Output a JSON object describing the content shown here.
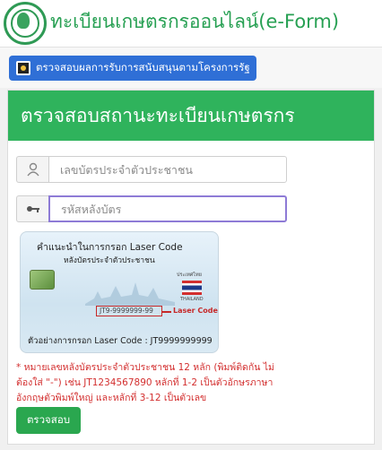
{
  "header": {
    "title": "ทะเบียนเกษตรกรออนไลน์(e-Form)"
  },
  "toolbar": {
    "gov_button_label": "ตรวจสอบผลการรับการสนับสนุนตามโครงการรัฐ"
  },
  "card": {
    "heading": "ตรวจสอบสถานะทะเบียนเกษตรกร",
    "id_input": {
      "placeholder": "เลขบัตรประจำตัวประชาชน",
      "value": ""
    },
    "laser_input": {
      "placeholder": "รหัสหลังบัตร",
      "value": ""
    },
    "id_card_image": {
      "title": "คำแนะนำในการกรอก Laser Code",
      "subtitle": "หลังบัตรประจำตัวประชาชน",
      "country": "ประเทศไทย",
      "country_en": "THAILAND",
      "laser_code_sample": "JT9-9999999-99",
      "laser_label": "Laser Code",
      "example": "ตัวอย่างการกรอก Laser Code : JT9999999999"
    },
    "note": "* หมายเลขหลังบัตรประจำตัวประชาชน 12 หลัก (พิมพ์ติดกัน ไม่ต้องใส่ \"-\") เช่น JT1234567890 หลักที่ 1-2 เป็นตัวอักษรภาษาอังกฤษตัวพิมพ์ใหญ่ และหลักที่ 3-12 เป็นตัวเลข",
    "submit_label": "ตรวจสอบ"
  },
  "colors": {
    "brand_green": "#2fb35c",
    "button_blue": "#2f6fd6",
    "note_red": "#d32f2f",
    "focus_border": "#8e7bd6"
  },
  "icons": {
    "id_addon": "user-icon",
    "laser_addon": "key-icon"
  }
}
